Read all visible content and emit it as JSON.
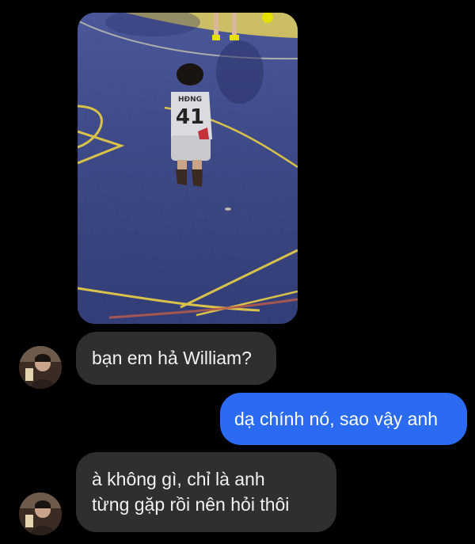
{
  "chat": {
    "image": {
      "alt_desc": "",
      "jersey_name": "HĐNG",
      "jersey_number": "41"
    },
    "messages": [
      {
        "from": "them",
        "lines": [
          "bạn em hả William?"
        ]
      },
      {
        "from": "me",
        "lines": [
          "dạ chính nó, sao vậy anh"
        ]
      },
      {
        "from": "them",
        "lines": [
          "à không gì, chỉ là anh",
          "từng gặp rồi nên hỏi thôi"
        ]
      }
    ]
  },
  "colors": {
    "background": "#000000",
    "incoming_bubble": "#2f2f2f",
    "outgoing_bubble": "#2b6bf2",
    "court": "#3f4c8e",
    "court_lines": "#d8c24a"
  }
}
